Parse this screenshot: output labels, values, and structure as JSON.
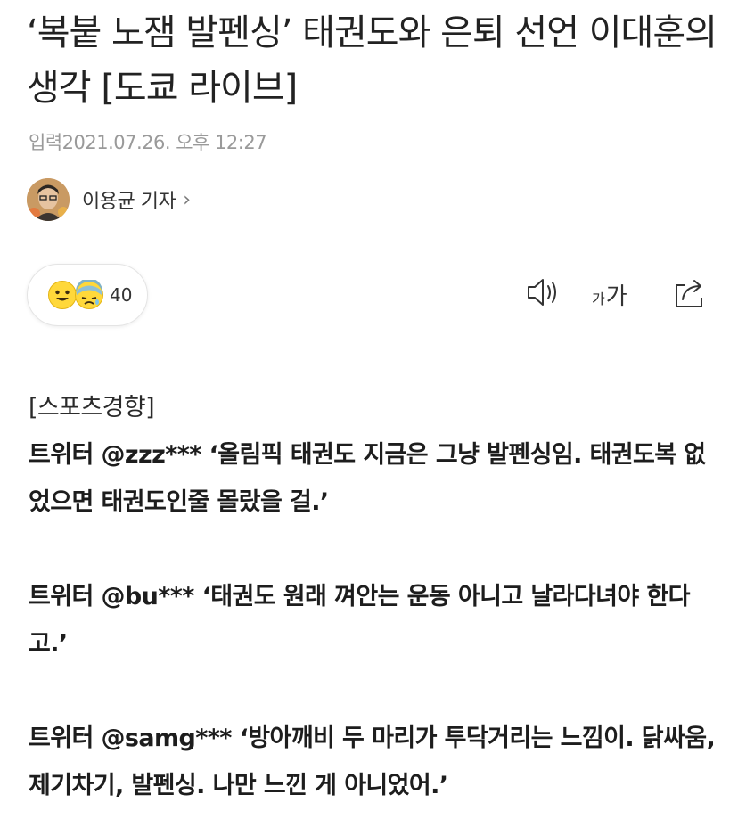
{
  "article": {
    "title": "‘복붙 노잼 발펜싱’ 태권도와 은퇴 선언 이대훈의 생각 [도쿄 라이브]",
    "dateline": "입력2021.07.26. 오후 12:27"
  },
  "reporter": {
    "name": "이용균 기자"
  },
  "reactions": {
    "count": "40",
    "icons": [
      "smiling-face-icon",
      "sad-face-icon"
    ]
  },
  "toolbar": {
    "font_small": "가",
    "font_big": "가",
    "icons": [
      "speaker-icon",
      "font-size-icon",
      "share-icon"
    ]
  },
  "content": {
    "source": "[스포츠경향]",
    "tweets": [
      "트위터 @zzz*** ‘올림픽 태권도 지금은 그냥 발펜싱임. 태권도복 없었으면 태권도인줄 몰랐을 걸.’",
      "트위터 @bu*** ‘태권도 원래 껴안는 운동 아니고 날라다녀야 한다고.’",
      "트위터 @samg*** ‘방아깨비 두 마리가 투닥거리는 느낌이. 닭싸움, 제기차기, 발펜싱. 나만 느낀 게 아니었어.’"
    ]
  }
}
